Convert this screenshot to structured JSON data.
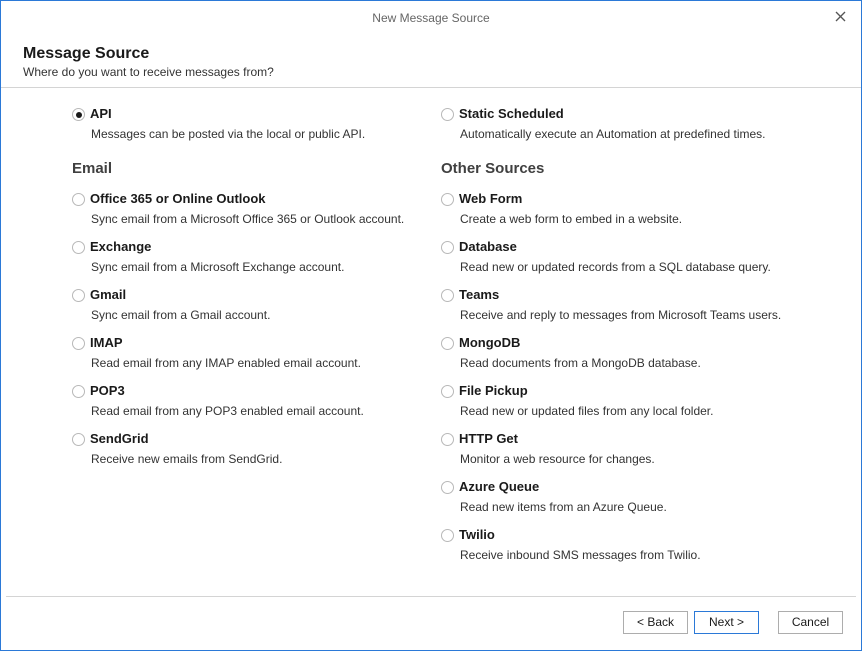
{
  "window": {
    "title": "New Message Source"
  },
  "header": {
    "title": "Message Source",
    "subtitle": "Where do you want to receive messages from?"
  },
  "selected": "api",
  "left": {
    "top_option": {
      "id": "api",
      "label": "API",
      "desc": "Messages can be posted via the local or public API."
    },
    "section": "Email",
    "options": [
      {
        "id": "office365",
        "label": "Office 365 or Online Outlook",
        "desc": "Sync email from a Microsoft Office 365 or Outlook account."
      },
      {
        "id": "exchange",
        "label": "Exchange",
        "desc": "Sync email from a Microsoft Exchange account."
      },
      {
        "id": "gmail",
        "label": "Gmail",
        "desc": "Sync email from a Gmail account."
      },
      {
        "id": "imap",
        "label": "IMAP",
        "desc": "Read email from any IMAP enabled email account."
      },
      {
        "id": "pop3",
        "label": "POP3",
        "desc": "Read email from any POP3 enabled email account."
      },
      {
        "id": "sendgrid",
        "label": "SendGrid",
        "desc": "Receive new emails from SendGrid."
      }
    ]
  },
  "right": {
    "top_option": {
      "id": "static-scheduled",
      "label": "Static Scheduled",
      "desc": "Automatically execute an Automation at predefined times."
    },
    "section": "Other Sources",
    "options": [
      {
        "id": "web-form",
        "label": "Web Form",
        "desc": "Create a web form to embed in a website."
      },
      {
        "id": "database",
        "label": "Database",
        "desc": "Read new or updated records from a SQL database query."
      },
      {
        "id": "teams",
        "label": "Teams",
        "desc": "Receive and reply to messages from Microsoft Teams users."
      },
      {
        "id": "mongodb",
        "label": "MongoDB",
        "desc": "Read documents from a MongoDB database."
      },
      {
        "id": "file-pickup",
        "label": "File Pickup",
        "desc": "Read new or updated files from any local folder."
      },
      {
        "id": "http-get",
        "label": "HTTP Get",
        "desc": "Monitor a web resource for changes."
      },
      {
        "id": "azure-queue",
        "label": "Azure Queue",
        "desc": "Read new items from an Azure Queue."
      },
      {
        "id": "twilio",
        "label": "Twilio",
        "desc": "Receive inbound SMS messages from Twilio."
      }
    ]
  },
  "footer": {
    "back_label": "< Back",
    "next_label": "Next >",
    "cancel_label": "Cancel"
  },
  "icons": {
    "close": "close-icon"
  },
  "colors": {
    "accent": "#2b79d7",
    "divider": "#d4d4d4"
  }
}
